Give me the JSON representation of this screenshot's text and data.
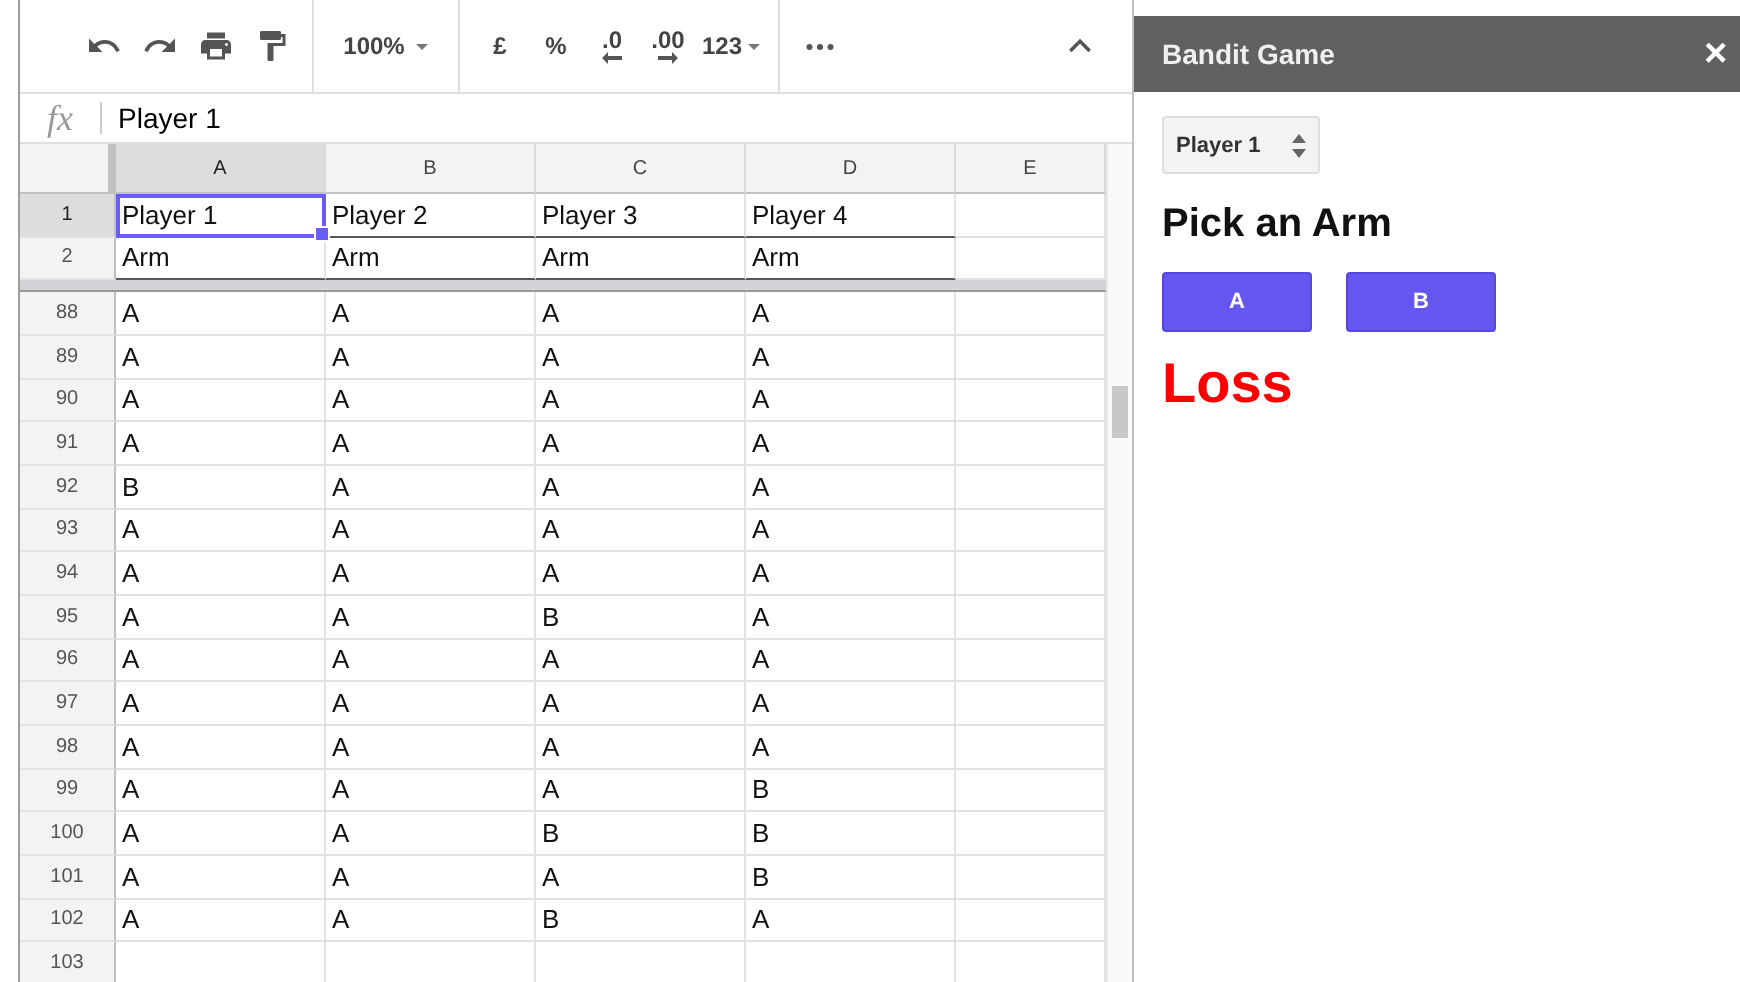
{
  "toolbar": {
    "zoom": "100%",
    "currency": "£",
    "percent": "%",
    "decrease_decimals": ".0",
    "increase_decimals": ".00",
    "number_format": "123"
  },
  "formula_bar": {
    "label": "fx",
    "value": "Player 1"
  },
  "columns": [
    {
      "label": "A",
      "selected": true
    },
    {
      "label": "B",
      "selected": false
    },
    {
      "label": "C",
      "selected": false
    },
    {
      "label": "D",
      "selected": false
    },
    {
      "label": "E",
      "selected": false
    }
  ],
  "frozen_rows": [
    {
      "label": "1",
      "selected": true,
      "cells": [
        "Player 1",
        "Player 2",
        "Player 3",
        "Player 4"
      ]
    },
    {
      "label": "2",
      "selected": false,
      "cells": [
        "Arm",
        "Arm",
        "Arm",
        "Arm"
      ]
    }
  ],
  "rows": [
    {
      "label": "88",
      "selected": false,
      "cells": [
        "A",
        "A",
        "A",
        "A"
      ]
    },
    {
      "label": "89",
      "selected": false,
      "cells": [
        "A",
        "A",
        "A",
        "A"
      ]
    },
    {
      "label": "90",
      "selected": false,
      "cells": [
        "A",
        "A",
        "A",
        "A"
      ]
    },
    {
      "label": "91",
      "selected": false,
      "cells": [
        "A",
        "A",
        "A",
        "A"
      ]
    },
    {
      "label": "92",
      "selected": false,
      "cells": [
        "B",
        "A",
        "A",
        "A"
      ]
    },
    {
      "label": "93",
      "selected": false,
      "cells": [
        "A",
        "A",
        "A",
        "A"
      ]
    },
    {
      "label": "94",
      "selected": false,
      "cells": [
        "A",
        "A",
        "A",
        "A"
      ]
    },
    {
      "label": "95",
      "selected": false,
      "cells": [
        "A",
        "A",
        "B",
        "A"
      ]
    },
    {
      "label": "96",
      "selected": false,
      "cells": [
        "A",
        "A",
        "A",
        "A"
      ]
    },
    {
      "label": "97",
      "selected": false,
      "cells": [
        "A",
        "A",
        "A",
        "A"
      ]
    },
    {
      "label": "98",
      "selected": false,
      "cells": [
        "A",
        "A",
        "A",
        "A"
      ]
    },
    {
      "label": "99",
      "selected": false,
      "cells": [
        "A",
        "A",
        "A",
        "B"
      ]
    },
    {
      "label": "100",
      "selected": false,
      "cells": [
        "A",
        "A",
        "B",
        "B"
      ]
    },
    {
      "label": "101",
      "selected": false,
      "cells": [
        "A",
        "A",
        "A",
        "B"
      ]
    },
    {
      "label": "102",
      "selected": false,
      "cells": [
        "A",
        "A",
        "B",
        "A"
      ]
    },
    {
      "label": "103",
      "selected": false
    }
  ],
  "sidebar": {
    "title": "Bandit Game",
    "close": "×",
    "player_select": "Player 1",
    "heading": "Pick an Arm",
    "buttons": [
      "A",
      "B"
    ],
    "result": "Loss"
  }
}
